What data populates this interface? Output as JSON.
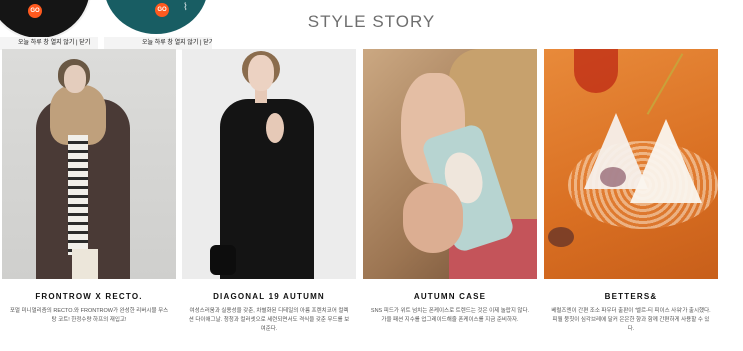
{
  "popups": [
    {
      "badge": "GO",
      "close_text": "오늘 하루 창 열지 않기 | 닫기"
    },
    {
      "badge": "GO",
      "close_text": "오늘 하루 창 열지 않기 | 닫기"
    }
  ],
  "section_title": "STYLE STORY",
  "stories": [
    {
      "title": "FRONTROW X RECTO.",
      "desc": "포멀 미니멀리즘의 RECTO.와 FRONTROW가 완성한 리버시블 무스탕 코트! 한정수량 하프의 재입고!"
    },
    {
      "title": "DIAGONAL 19 AUTUMN",
      "desc": "여성스러움과 실용성을 갖춘, 차별화된 디테일의 아름 프렌치코어 컬렉션 다이애그날. 청청과 컬러셋으로 세련되면서도 격식을 갖춘 무드를 보여준다."
    },
    {
      "title": "AUTUMN CASE",
      "desc": "SNS 피드가 위트 넘치는 폰케이스로 트렌드는 것은 이제 놀랍지 않다. 가을 패션 지수를 업그레이드해줄 폰케이스를 지금 준비하자."
    },
    {
      "title": "BETTERS&",
      "desc": "베럴즈엔이 간편 조소 파우더 출판이 '벨르-티 피이스 사워'가 출시했다. 피윌 뭉칫이 심각브레에 달커 은은한 향과 함께 간편하게 사용할 수 있다."
    }
  ]
}
